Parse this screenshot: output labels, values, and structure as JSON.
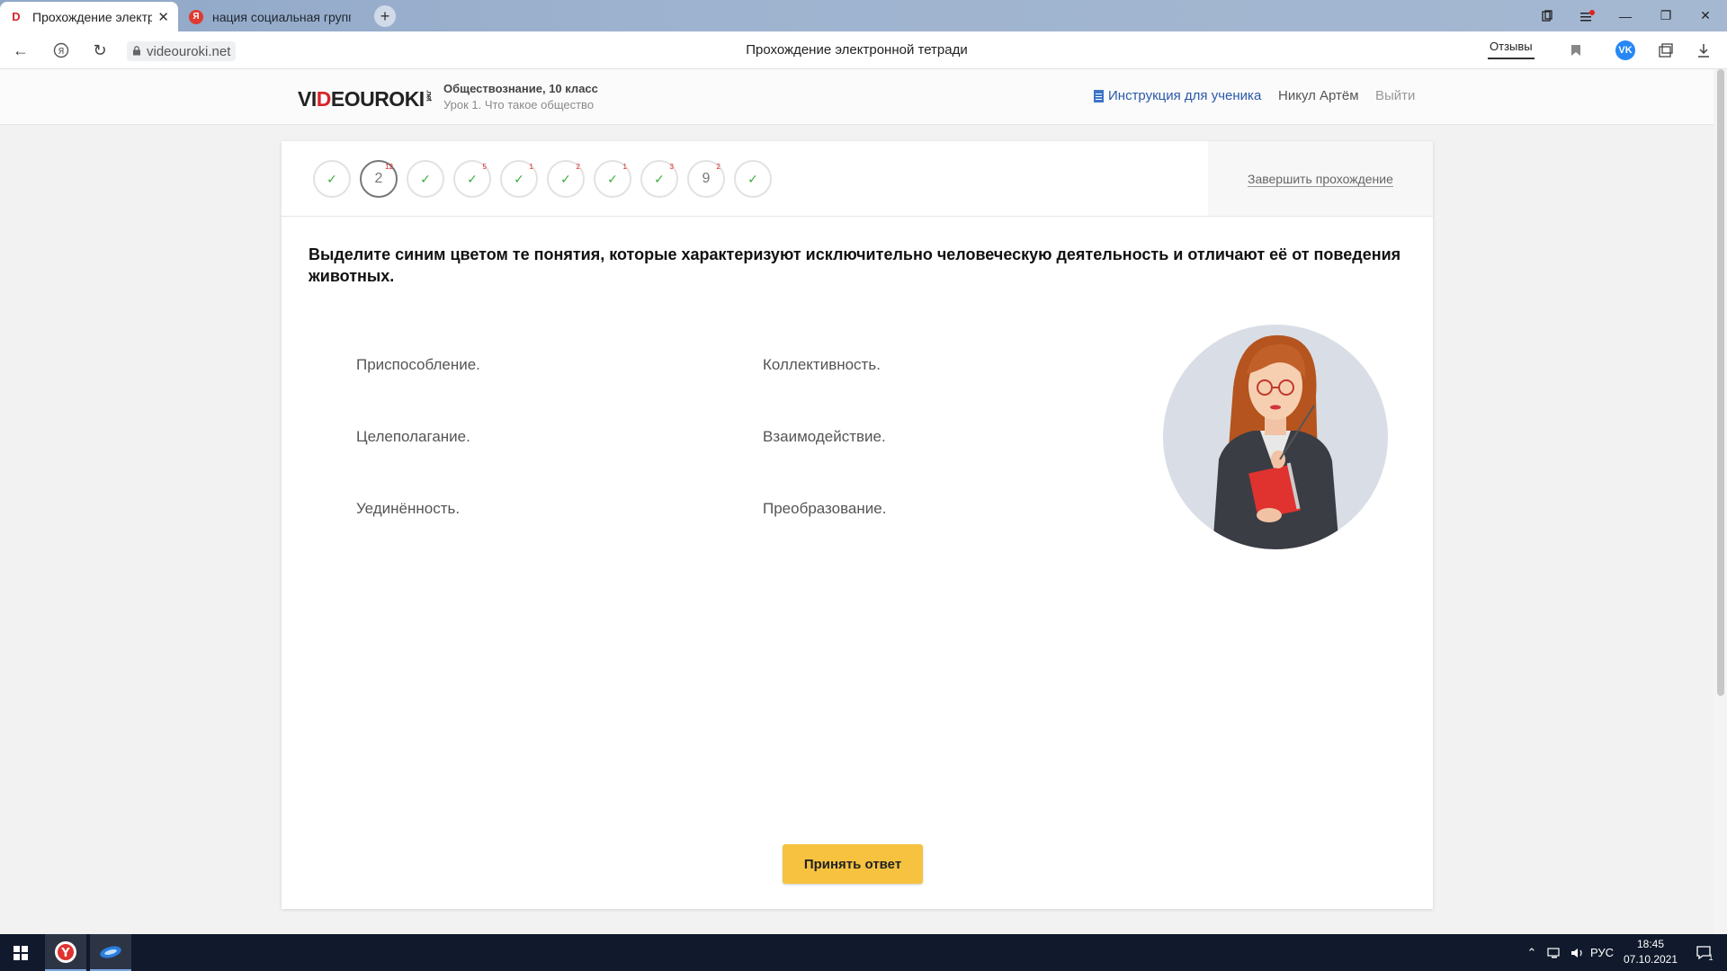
{
  "browser": {
    "tabs": [
      {
        "title": "Прохождение электро",
        "active": true
      },
      {
        "title": "нация социальная группа",
        "active": false
      }
    ],
    "url": "videouroki.net",
    "page_title": "Прохождение электронной тетради",
    "reviews_label": "Отзывы",
    "vk_label": "VK"
  },
  "site": {
    "logo_prefix": "VI",
    "logo_accent": "D",
    "logo_suffix": "EOUROKI",
    "logo_net": ".net",
    "subject": "Обществознание, 10 класс",
    "lesson": "Урок 1. Что такое общество",
    "instruction_link": "Инструкция для ученика",
    "user_name": "Никул Артём",
    "logout": "Выйти"
  },
  "progress": {
    "steps": [
      {
        "state": "done",
        "label": "✓",
        "badge": ""
      },
      {
        "state": "current",
        "label": "2",
        "badge": "12"
      },
      {
        "state": "done",
        "label": "✓",
        "badge": ""
      },
      {
        "state": "done",
        "label": "✓",
        "badge": "5"
      },
      {
        "state": "done",
        "label": "✓",
        "badge": "1"
      },
      {
        "state": "done",
        "label": "✓",
        "badge": "2"
      },
      {
        "state": "done",
        "label": "✓",
        "badge": "1"
      },
      {
        "state": "done",
        "label": "✓",
        "badge": "3"
      },
      {
        "state": "pending",
        "label": "9",
        "badge": "2"
      },
      {
        "state": "done",
        "label": "✓",
        "badge": ""
      }
    ],
    "finish_label": "Завершить прохождение"
  },
  "task": {
    "question": "Выделите синим цветом те понятия, которые характеризуют исключительно человеческую деятельность и отличают её от поведения животных.",
    "options": [
      "Приспособление.",
      "Коллективность.",
      "Целеполагание.",
      "Взаимодействие.",
      "Уединённость.",
      "Преобразование."
    ],
    "submit_label": "Принять ответ"
  },
  "taskbar": {
    "language": "РУС",
    "time": "18:45",
    "date": "07.10.2021",
    "notifications": "1"
  },
  "colors": {
    "accent_yellow": "#f6c23f",
    "check_green": "#3cae3c",
    "link_blue": "#2b5aa8",
    "logo_red": "#d8232a"
  }
}
